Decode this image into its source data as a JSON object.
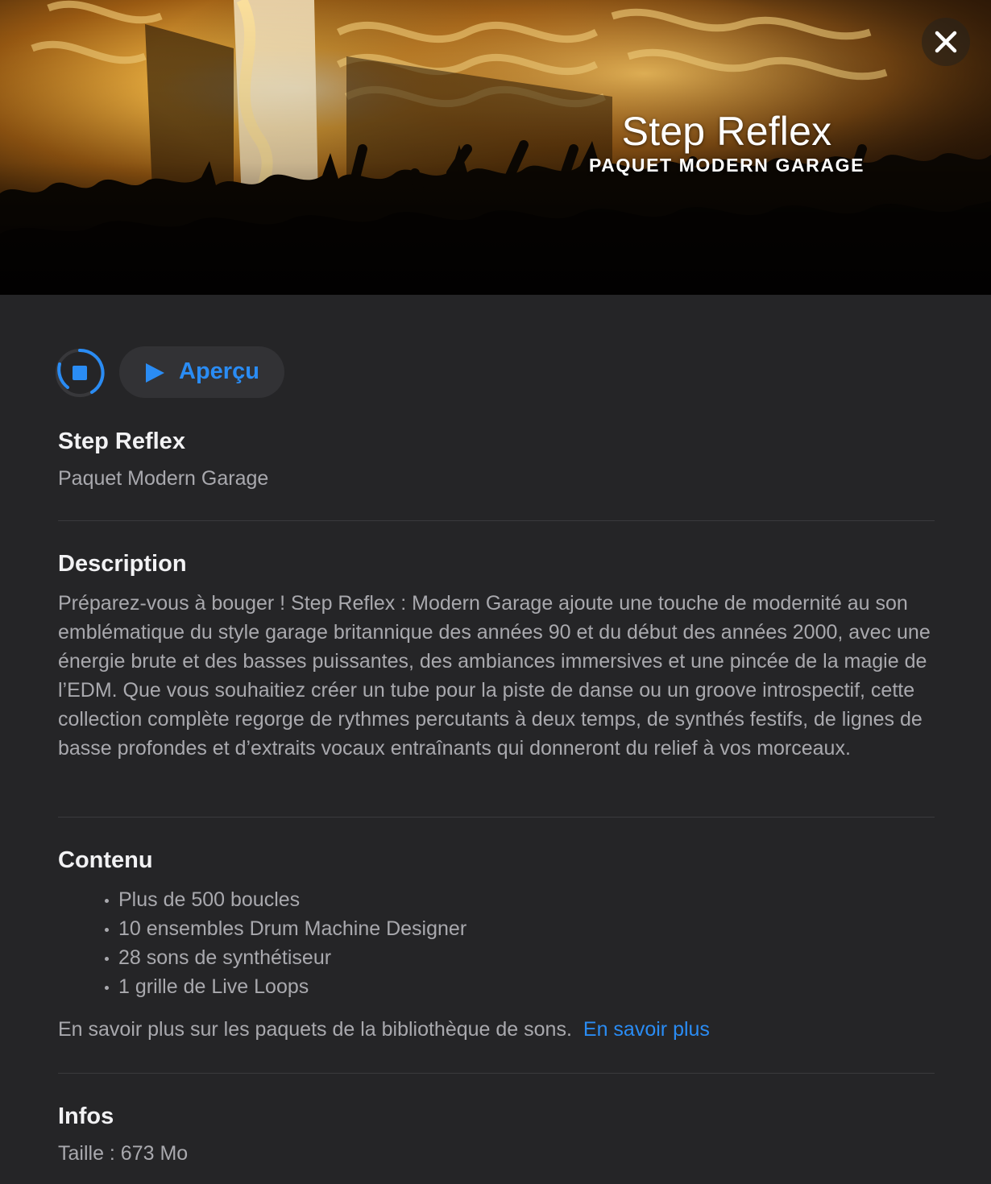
{
  "hero": {
    "title": "Step Reflex",
    "subtitle": "PAQUET MODERN GARAGE"
  },
  "controls": {
    "preview_label": "Aperçu"
  },
  "header": {
    "title": "Step Reflex",
    "subtitle": "Paquet Modern Garage"
  },
  "description": {
    "heading": "Description",
    "text": "Préparez-vous à bouger ! Step Reflex : Modern Garage ajoute une touche de modernité au son emblématique du style garage britannique des années 90 et du début des années 2000, avec une énergie brute et des basses puissantes, des ambiances immersives et une pincée de la magie de l’EDM. Que vous souhaitiez créer un tube pour la piste de danse ou un groove introspectif, cette collection complète regorge de rythmes percutants à deux temps, de synthés festifs, de lignes de basse profondes et d’extraits vocaux entraînants qui donneront du relief à vos morceaux."
  },
  "contents": {
    "heading": "Contenu",
    "items": [
      "Plus de 500 boucles",
      "10 ensembles Drum Machine Designer",
      "28 sons de synthétiseur",
      "1 grille de Live Loops"
    ],
    "learn_text": "En savoir plus sur les paquets de la bibliothèque de sons.",
    "learn_link": "En savoir plus"
  },
  "info": {
    "heading": "Infos",
    "size": "Taille : 673 Mo"
  },
  "colors": {
    "accent": "#2a8cf4",
    "background": "#252527",
    "button_bg": "#323235"
  },
  "icons": {
    "close": "close-icon",
    "stop": "stop-icon",
    "play": "play-icon"
  }
}
